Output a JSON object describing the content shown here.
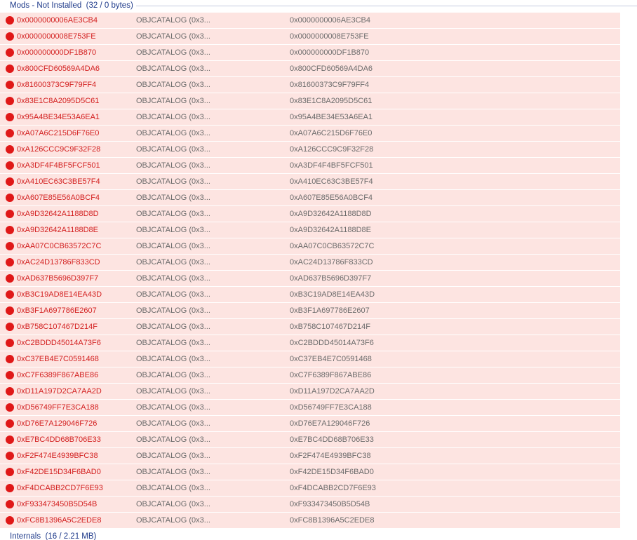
{
  "group": {
    "title": "Mods - Not Installed",
    "summary": "(32 / 0 bytes)"
  },
  "next_group": {
    "title": "Internals",
    "summary": "(16 / 2.21 MB)"
  },
  "colors": {
    "row_background": "#fde4e1",
    "status_dot": "#e01818",
    "name_text": "#d32020",
    "header_text": "#1e3a8a"
  },
  "rows": [
    {
      "name": "0x0000000006AE3CB4",
      "type": "OBJCATALOG (0x3...",
      "value": "0x0000000006AE3CB4"
    },
    {
      "name": "0x0000000008E753FE",
      "type": "OBJCATALOG (0x3...",
      "value": "0x0000000008E753FE"
    },
    {
      "name": "0x000000000DF1B870",
      "type": "OBJCATALOG (0x3...",
      "value": "0x000000000DF1B870"
    },
    {
      "name": "0x800CFD60569A4DA6",
      "type": "OBJCATALOG (0x3...",
      "value": "0x800CFD60569A4DA6"
    },
    {
      "name": "0x81600373C9F79FF4",
      "type": "OBJCATALOG (0x3...",
      "value": "0x81600373C9F79FF4"
    },
    {
      "name": "0x83E1C8A2095D5C61",
      "type": "OBJCATALOG (0x3...",
      "value": "0x83E1C8A2095D5C61"
    },
    {
      "name": "0x95A4BE34E53A6EA1",
      "type": "OBJCATALOG (0x3...",
      "value": "0x95A4BE34E53A6EA1"
    },
    {
      "name": "0xA07A6C215D6F76E0",
      "type": "OBJCATALOG (0x3...",
      "value": "0xA07A6C215D6F76E0"
    },
    {
      "name": "0xA126CCC9C9F32F28",
      "type": "OBJCATALOG (0x3...",
      "value": "0xA126CCC9C9F32F28"
    },
    {
      "name": "0xA3DF4F4BF5FCF501",
      "type": "OBJCATALOG (0x3...",
      "value": "0xA3DF4F4BF5FCF501"
    },
    {
      "name": "0xA410EC63C3BE57F4",
      "type": "OBJCATALOG (0x3...",
      "value": "0xA410EC63C3BE57F4"
    },
    {
      "name": "0xA607E85E56A0BCF4",
      "type": "OBJCATALOG (0x3...",
      "value": "0xA607E85E56A0BCF4"
    },
    {
      "name": "0xA9D32642A1188D8D",
      "type": "OBJCATALOG (0x3...",
      "value": "0xA9D32642A1188D8D"
    },
    {
      "name": "0xA9D32642A1188D8E",
      "type": "OBJCATALOG (0x3...",
      "value": "0xA9D32642A1188D8E"
    },
    {
      "name": "0xAA07C0CB63572C7C",
      "type": "OBJCATALOG (0x3...",
      "value": "0xAA07C0CB63572C7C"
    },
    {
      "name": "0xAC24D13786F833CD",
      "type": "OBJCATALOG (0x3...",
      "value": "0xAC24D13786F833CD"
    },
    {
      "name": "0xAD637B5696D397F7",
      "type": "OBJCATALOG (0x3...",
      "value": "0xAD637B5696D397F7"
    },
    {
      "name": "0xB3C19AD8E14EA43D",
      "type": "OBJCATALOG (0x3...",
      "value": "0xB3C19AD8E14EA43D"
    },
    {
      "name": "0xB3F1A697786E2607",
      "type": "OBJCATALOG (0x3...",
      "value": "0xB3F1A697786E2607"
    },
    {
      "name": "0xB758C107467D214F",
      "type": "OBJCATALOG (0x3...",
      "value": "0xB758C107467D214F"
    },
    {
      "name": "0xC2BDDD45014A73F6",
      "type": "OBJCATALOG (0x3...",
      "value": "0xC2BDDD45014A73F6"
    },
    {
      "name": "0xC37EB4E7C0591468",
      "type": "OBJCATALOG (0x3...",
      "value": "0xC37EB4E7C0591468"
    },
    {
      "name": "0xC7F6389F867ABE86",
      "type": "OBJCATALOG (0x3...",
      "value": "0xC7F6389F867ABE86"
    },
    {
      "name": "0xD11A197D2CA7AA2D",
      "type": "OBJCATALOG (0x3...",
      "value": "0xD11A197D2CA7AA2D"
    },
    {
      "name": "0xD56749FF7E3CA188",
      "type": "OBJCATALOG (0x3...",
      "value": "0xD56749FF7E3CA188"
    },
    {
      "name": "0xD76E7A129046F726",
      "type": "OBJCATALOG (0x3...",
      "value": "0xD76E7A129046F726"
    },
    {
      "name": "0xE7BC4DD68B706E33",
      "type": "OBJCATALOG (0x3...",
      "value": "0xE7BC4DD68B706E33"
    },
    {
      "name": "0xF2F474E4939BFC38",
      "type": "OBJCATALOG (0x3...",
      "value": "0xF2F474E4939BFC38"
    },
    {
      "name": "0xF42DE15D34F6BAD0",
      "type": "OBJCATALOG (0x3...",
      "value": "0xF42DE15D34F6BAD0"
    },
    {
      "name": "0xF4DCABB2CD7F6E93",
      "type": "OBJCATALOG (0x3...",
      "value": "0xF4DCABB2CD7F6E93"
    },
    {
      "name": "0xF933473450B5D54B",
      "type": "OBJCATALOG (0x3...",
      "value": "0xF933473450B5D54B"
    },
    {
      "name": "0xFC8B1396A5C2EDE8",
      "type": "OBJCATALOG (0x3...",
      "value": "0xFC8B1396A5C2EDE8"
    }
  ]
}
